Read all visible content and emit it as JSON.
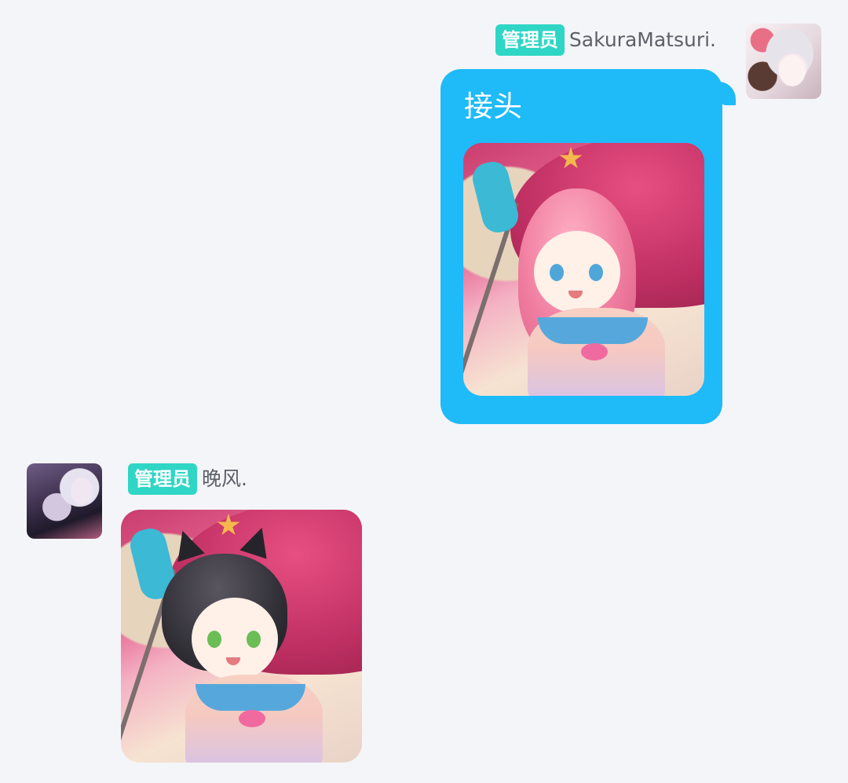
{
  "messages": [
    {
      "role_badge": "管理员",
      "sender_name": "SakuraMatsuri.",
      "text": "接头"
    },
    {
      "role_badge": "管理员",
      "sender_name": "晚风."
    }
  ],
  "colors": {
    "background": "#f4f5f9",
    "badge": "#2fd6c5",
    "bubble": "#1fbaf8"
  },
  "icons": [
    "user-avatar",
    "sticker-image"
  ]
}
